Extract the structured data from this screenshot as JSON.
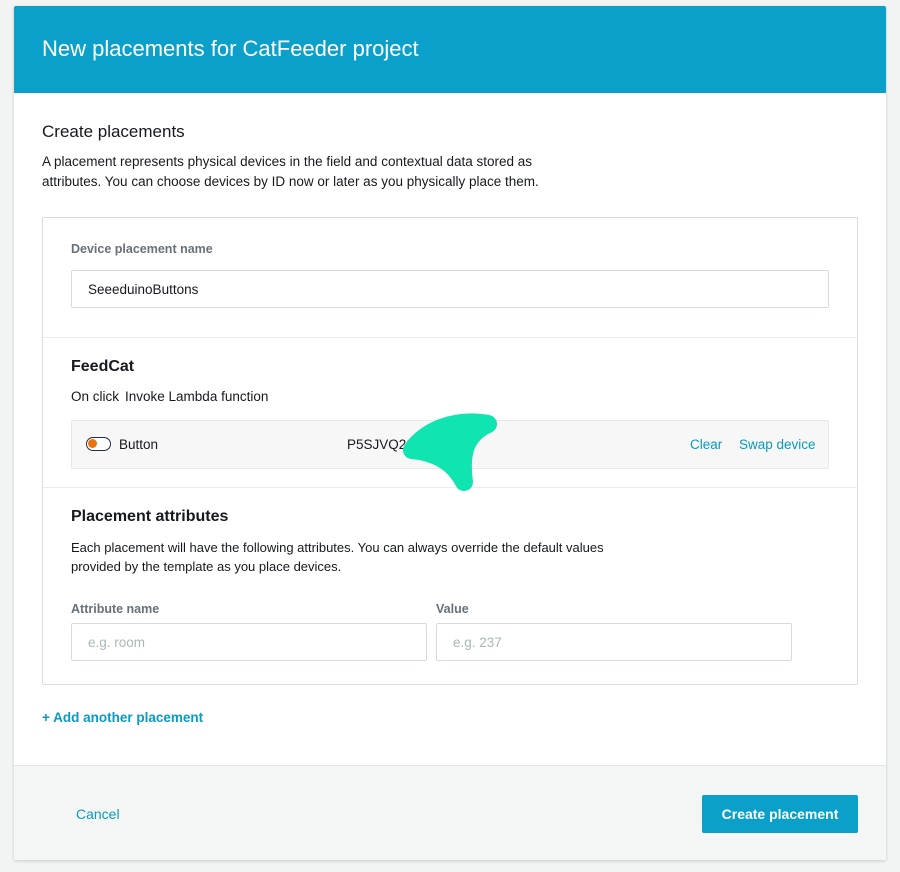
{
  "modal": {
    "title": "New placements for CatFeeder project"
  },
  "create_section": {
    "title": "Create placements",
    "description": "A placement represents physical devices in the field and contextual data stored as attributes. You can choose devices by ID now or later as you physically place them."
  },
  "placement_name": {
    "label": "Device placement name",
    "value": "SeeeduinoButtons"
  },
  "device_template": {
    "name": "FeedCat",
    "trigger_label": "On click",
    "action_label": "Invoke Lambda function",
    "device": {
      "icon": "toggle-switch-icon",
      "type": "Button",
      "id": "P5SJVQ20",
      "clear_label": "Clear",
      "swap_label": "Swap device"
    }
  },
  "attributes": {
    "title": "Placement attributes",
    "description": "Each placement will have the following attributes. You can always override the default values provided by the template as you place devices.",
    "name_label": "Attribute name",
    "name_placeholder": "e.g. room",
    "value_label": "Value",
    "value_placeholder": "e.g. 237"
  },
  "add_another_label": "+ Add another placement",
  "footer": {
    "cancel_label": "Cancel",
    "create_label": "Create placement"
  },
  "colors": {
    "brand": "#0ba0c9",
    "link": "#0a9ac2",
    "redaction": "#10e5b1",
    "toggle_knob": "#ec7211"
  }
}
